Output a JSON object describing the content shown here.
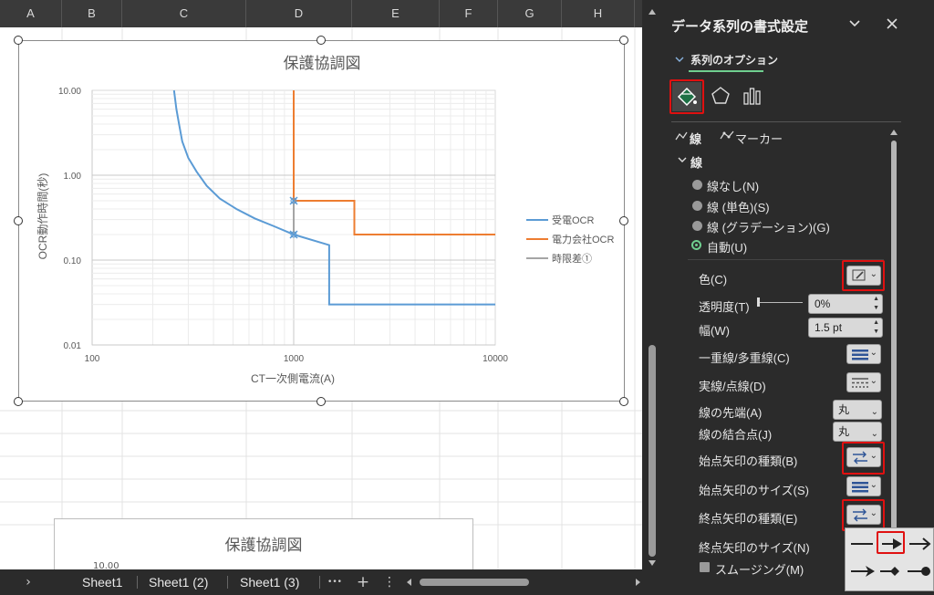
{
  "columns": [
    "A",
    "B",
    "C",
    "D",
    "E",
    "F",
    "G",
    "H"
  ],
  "chart": {
    "title": "保護協調図",
    "xlabel": "CT一次側電流(A)",
    "ylabel": "OCR動作時間(秒)",
    "y_ticks": [
      "10.00",
      "1.00",
      "0.10",
      "0.01"
    ],
    "x_ticks": [
      "100",
      "1000",
      "10000"
    ],
    "legend": [
      "受電OCR",
      "電力会社OCR",
      "時限差①"
    ]
  },
  "chart_data": {
    "type": "line",
    "title": "保護協調図",
    "xlabel": "CT一次側電流(A)",
    "ylabel": "OCR動作時間(秒)",
    "x_scale": "log",
    "y_scale": "log",
    "xlim": [
      100,
      10000
    ],
    "ylim": [
      0.01,
      10
    ],
    "grid": true,
    "legend_position": "right",
    "series": [
      {
        "name": "受電OCR",
        "color": "#5b9bd5",
        "points": [
          [
            255,
            10
          ],
          [
            262,
            6
          ],
          [
            270,
            4
          ],
          [
            280,
            2.5
          ],
          [
            300,
            1.6
          ],
          [
            330,
            1.1
          ],
          [
            370,
            0.75
          ],
          [
            430,
            0.53
          ],
          [
            520,
            0.4
          ],
          [
            640,
            0.31
          ],
          [
            800,
            0.25
          ],
          [
            1000,
            0.2
          ],
          [
            1500,
            0.15
          ],
          [
            1500,
            0.03
          ],
          [
            10000,
            0.03
          ]
        ]
      },
      {
        "name": "電力会社OCR",
        "color": "#ed7d31",
        "points": [
          [
            1000,
            10
          ],
          [
            1000,
            0.5
          ],
          [
            2000,
            0.5
          ],
          [
            2000,
            0.2
          ],
          [
            10000,
            0.2
          ]
        ]
      },
      {
        "name": "時限差①",
        "color": "#a5a5a5",
        "points": [
          [
            1000,
            0.5
          ],
          [
            1000,
            0.2
          ]
        ]
      }
    ]
  },
  "chart2": {
    "title": "保護協調図",
    "first_tick": "10.00"
  },
  "sheets": [
    "Sheet1",
    "Sheet1 (2)",
    "Sheet1 (3)"
  ],
  "bottom": {
    "prev": "›",
    "more": "•••",
    "add": "+",
    "menu": "⋮"
  },
  "pane": {
    "title": "データ系列の書式設定",
    "section": "系列のオプション",
    "tab_line": "線",
    "tab_marker": "マーカー",
    "group": "線",
    "radio_none": "線なし(N)",
    "radio_solid": "線 (単色)(S)",
    "radio_gradient": "線 (グラデーション)(G)",
    "radio_auto": "自動(U)",
    "color": "色(C)",
    "transparency": "透明度(T)",
    "transparency_value": "0%",
    "width": "幅(W)",
    "width_value": "1.5 pt",
    "compound": "一重線/多重線(C)",
    "dash": "実線/点線(D)",
    "cap": "線の先端(A)",
    "cap_value": "丸",
    "join": "線の結合点(J)",
    "join_value": "丸",
    "begin_type": "始点矢印の種類(B)",
    "begin_size": "始点矢印のサイズ(S)",
    "end_type": "終点矢印の種類(E)",
    "end_size": "終点矢印のサイズ(N)",
    "smoothing": "スムージング(M)"
  },
  "colors": {
    "accent_green": "#6fcf8f",
    "highlight_red": "#e01010",
    "fill_icon_green": "#1e7145"
  }
}
